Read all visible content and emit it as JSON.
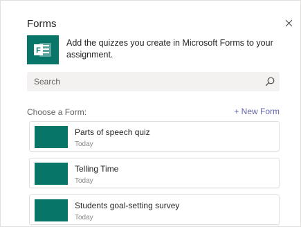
{
  "dialog": {
    "title": "Forms",
    "description": "Add the quizzes you create in Microsoft Forms to your assignment.",
    "close_icon": "close-icon",
    "app_icon": "microsoft-forms-icon",
    "app_icon_letter": "F"
  },
  "search": {
    "placeholder": "Search",
    "value": "",
    "icon": "search-icon"
  },
  "list_header": {
    "label": "Choose a Form:",
    "new_form_label": "+ New Form"
  },
  "forms": [
    {
      "title": "Parts of speech quiz",
      "date": "Today"
    },
    {
      "title": "Telling Time",
      "date": "Today"
    },
    {
      "title": "Students goal-setting survey",
      "date": "Today"
    }
  ],
  "colors": {
    "brand_green": "#077568",
    "accent_purple": "#6264a7"
  }
}
